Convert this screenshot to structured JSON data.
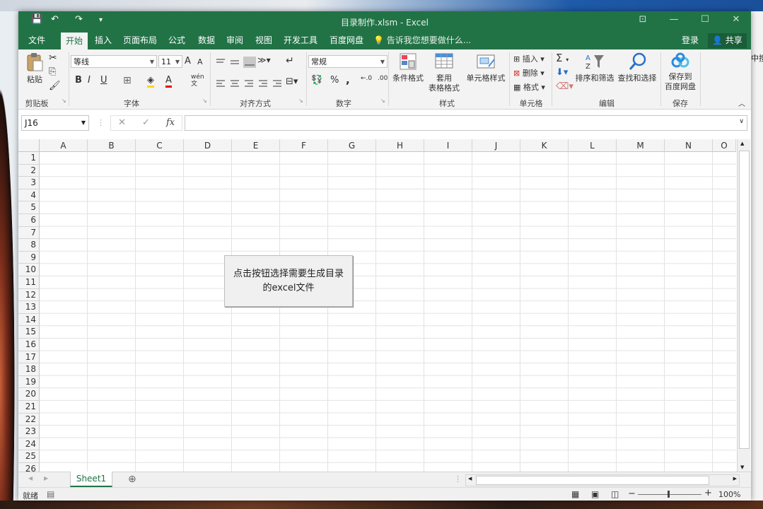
{
  "desktop": {
    "right_peek_text": "中搜"
  },
  "window": {
    "title": "目录制作.xlsm - Excel",
    "qa_save": "💾",
    "qa_undo": "↶",
    "qa_redo": "↷",
    "qa_custom": "▾",
    "controls": {
      "restore_ribbon": "⊡",
      "minimize": "—",
      "maximize": "☐",
      "close": "✕"
    }
  },
  "tabs": [
    "文件",
    "开始",
    "插入",
    "页面布局",
    "公式",
    "数据",
    "审阅",
    "视图",
    "开发工具",
    "百度网盘"
  ],
  "active_tab": "开始",
  "tell_me": "告诉我您想要做什么...",
  "account": {
    "login": "登录",
    "share": "共享"
  },
  "ribbon": {
    "clipboard": {
      "paste": "粘贴",
      "label": "剪贴板"
    },
    "font": {
      "name": "等线",
      "size": "11",
      "grow": "A",
      "shrink": "A",
      "bold": "B",
      "italic": "I",
      "underline": "U",
      "label": "字体",
      "wen": "文"
    },
    "align": {
      "label": "对齐方式"
    },
    "number": {
      "format": "常规",
      "percent": "%",
      "comma": ",",
      "inc": "←.0",
      "dec": ".00",
      "label": "数字"
    },
    "styles": {
      "cond": "条件格式",
      "table1": "套用",
      "table2": "表格格式",
      "cell": "单元格样式",
      "label": "样式"
    },
    "cells": {
      "insert": "插入",
      "delete": "删除",
      "format": "格式",
      "label": "单元格"
    },
    "edit": {
      "sigma": "Σ",
      "sort": "排序和筛选",
      "find": "查找和选择",
      "label": "编辑"
    },
    "save": {
      "line1": "保存到",
      "line2": "百度网盘",
      "label": "保存"
    }
  },
  "formula_bar": {
    "name_box": "J16",
    "cancel": "✕",
    "enter": "✓",
    "fx": "fx",
    "value": ""
  },
  "columns": [
    "A",
    "B",
    "C",
    "D",
    "E",
    "F",
    "G",
    "H",
    "I",
    "J",
    "K",
    "L",
    "M",
    "N",
    "O"
  ],
  "rows": [
    "1",
    "2",
    "3",
    "4",
    "5",
    "6",
    "7",
    "8",
    "9",
    "10",
    "11",
    "12",
    "13",
    "14",
    "15",
    "16",
    "17",
    "18",
    "19",
    "20",
    "21",
    "22",
    "23",
    "24",
    "25",
    "26"
  ],
  "macro_button": {
    "line1": "点击按钮选择需要生成目录",
    "line2": "的excel文件"
  },
  "sheets": {
    "active": "Sheet1",
    "add": "⊕"
  },
  "status": {
    "ready": "就绪",
    "zoom": "100%"
  }
}
